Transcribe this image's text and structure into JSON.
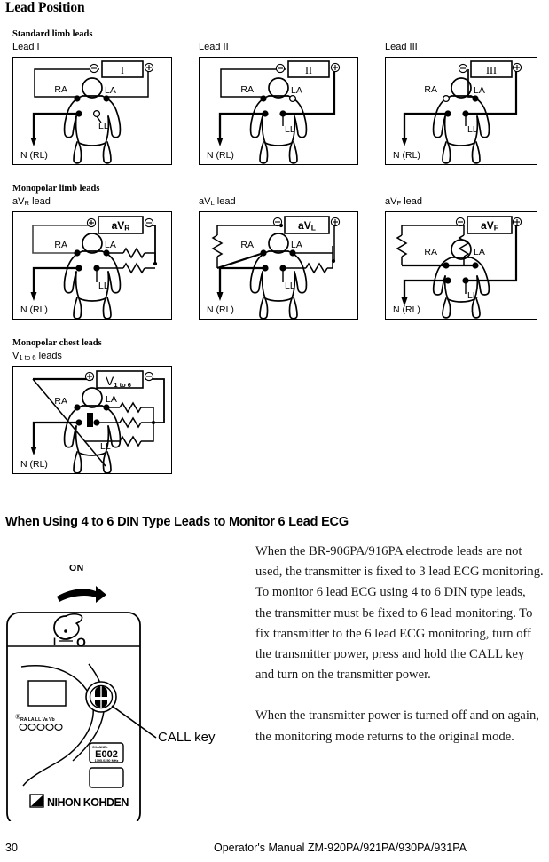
{
  "page": {
    "title": "Lead Position",
    "footer_page_number": "30",
    "footer_text": "Operator's Manual  ZM-920PA/921PA/930PA/931PA"
  },
  "groups": {
    "standard_limb": "Standard limb leads",
    "monopolar_limb": "Monopolar limb leads",
    "monopolar_chest": "Monopolar chest leads"
  },
  "diagrams": [
    {
      "caption": "Lead I",
      "meter_label": "I",
      "left_sign": "⊖",
      "right_sign": "⊕",
      "electrodes": {
        "ra": "RA",
        "la": "LA",
        "ll": "LL",
        "n": "N (RL)"
      }
    },
    {
      "caption": "Lead II",
      "meter_label": "II",
      "left_sign": "⊖",
      "right_sign": "⊕",
      "electrodes": {
        "ra": "RA",
        "la": "LA",
        "ll": "LL",
        "n": "N (RL)"
      }
    },
    {
      "caption": "Lead III",
      "meter_label": "III",
      "left_sign": "⊖",
      "right_sign": "⊕",
      "electrodes": {
        "ra": "RA",
        "la": "LA",
        "ll": "LL",
        "n": "N (RL)"
      }
    },
    {
      "caption": "aVR lead",
      "caption_main": "aV",
      "caption_sub": "R",
      "caption_tail": " lead",
      "meter_main": "aV",
      "meter_sub": "R",
      "left_sign": "⊕",
      "right_sign": "⊖",
      "electrodes": {
        "ra": "RA",
        "la": "LA",
        "ll": "LL",
        "n": "N (RL)"
      }
    },
    {
      "caption": "aVL lead",
      "caption_main": "aV",
      "caption_sub": "L",
      "caption_tail": " lead",
      "meter_main": "aV",
      "meter_sub": "L",
      "left_sign": "⊖",
      "right_sign": "⊕",
      "electrodes": {
        "ra": "RA",
        "la": "LA",
        "ll": "LL",
        "n": "N (RL)"
      }
    },
    {
      "caption": "aVF lead",
      "caption_main": "aV",
      "caption_sub": "F",
      "caption_tail": " lead",
      "meter_main": "aV",
      "meter_sub": "F",
      "left_sign": "⊖",
      "right_sign": "⊕",
      "electrodes": {
        "ra": "RA",
        "la": "LA",
        "ll": "LL",
        "n": "N (RL)"
      }
    },
    {
      "caption": "V1 to V6 leads",
      "caption_main": "V",
      "caption_sub": "1 to 6",
      "caption_tail": " leads",
      "meter_main": "V",
      "meter_sub": "1 to 6",
      "left_sign": "⊕",
      "right_sign": "⊖",
      "electrodes": {
        "ra": "RA",
        "la": "LA",
        "ll": "LL",
        "n": "N (RL)"
      }
    }
  ],
  "section": {
    "heading": "When Using 4 to 6 DIN Type Leads to Monitor 6 Lead ECG",
    "paragraph_1": "When the BR-906PA/916PA electrode leads are not used, the transmitter is fixed to 3 lead ECG monitoring. To monitor 6 lead ECG using 4 to 6 DIN type leads, the transmitter must be fixed to 6 lead monitoring. To fix transmitter to the 6 lead ECG monitoring, turn off the transmitter power, press and hold the CALL key and turn on the transmitter power.",
    "paragraph_2": "When the transmitter power is turned off and on again, the monitoring mode returns to the original mode."
  },
  "device": {
    "on_label": "ON",
    "callout_label": "CALL key",
    "switch_off_mark": "I",
    "switch_on_mark": "O",
    "connector_labels": "RA LA LL Va Vb",
    "channel_title": "CHANNEL",
    "channel_code": "E002",
    "frequency": "1395.0250 MHz",
    "brand": "NIHON KOHDEN"
  },
  "colors": {
    "ink": "#000000",
    "text": "#1a1a1a",
    "wire_gray": "#555555"
  }
}
